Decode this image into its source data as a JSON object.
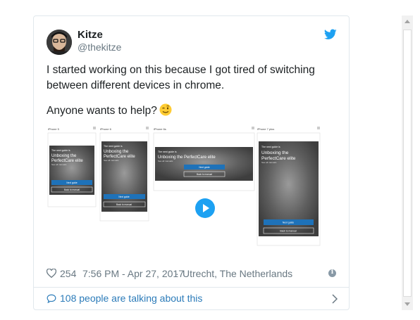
{
  "tweet": {
    "author_name": "Kitze",
    "author_handle": "@thekitze",
    "text_line1": "I started working on this because I got tired of switching between different devices in chrome.",
    "text_line2": "Anyone wants to help?",
    "emoji_icon": "winking-face-emoji",
    "likes": "254",
    "timestamp": "7:56 PM - Apr 27, 2017",
    "separator": "·",
    "location": "Utrecht, The Netherlands",
    "talk_label": "108 people are talking about this"
  },
  "media": {
    "devices": [
      {
        "label": "iPhone 5",
        "guide": "The next guide is",
        "title": "Unboxing the PerfectCare elite",
        "sub": "See all manuals",
        "primary": "Next guide",
        "secondary": "Back to manual"
      },
      {
        "label": "iPhone 6",
        "guide": "The next guide is",
        "title": "Unboxing the PerfectCare elite",
        "sub": "See all manuals",
        "primary": "Next guide",
        "secondary": "Back to manual"
      },
      {
        "label": "iPhone 6s",
        "guide": "The next guide is",
        "title": "Unboxing the PerfectCare elite",
        "sub": "See all manuals",
        "primary": "Next guide",
        "secondary": "Back to manual"
      },
      {
        "label": "iPhone 7 plus",
        "guide": "The next guide is",
        "title": "Unboxing the PerfectCare elite",
        "sub": "See all manuals",
        "primary": "Next guide",
        "secondary": "Back to manual"
      }
    ]
  },
  "colors": {
    "twitter_blue": "#1da1f2",
    "link": "#2b7bb9",
    "muted": "#697882",
    "button_blue": "#1e72b9"
  }
}
